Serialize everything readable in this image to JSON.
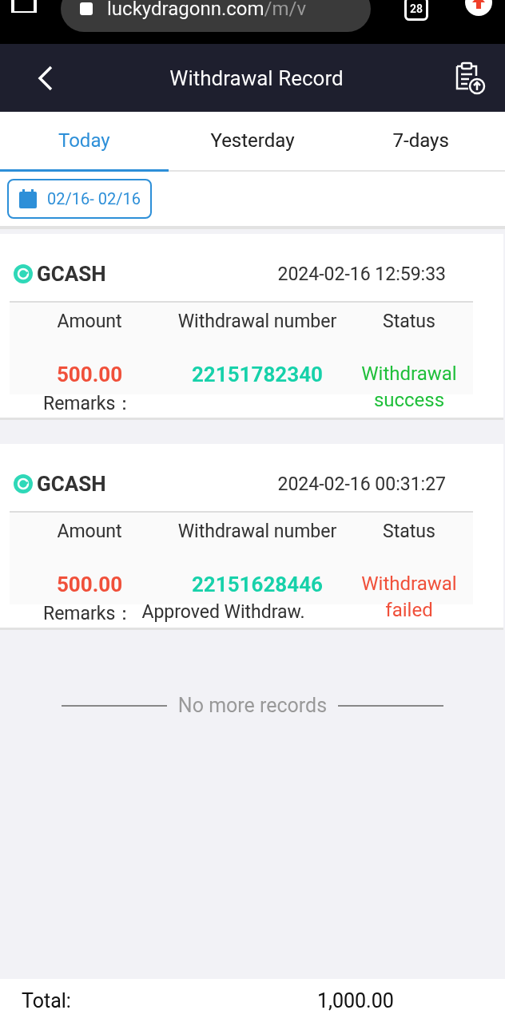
{
  "browser": {
    "url_host": "luckydragonn.com",
    "url_path": "/m/v",
    "tab_count": "28"
  },
  "header": {
    "title": "Withdrawal Record"
  },
  "tabs": [
    {
      "label": "Today",
      "selected": true
    },
    {
      "label": "Yesterday",
      "selected": false
    },
    {
      "label": "7-days",
      "selected": false
    }
  ],
  "date_range": "02/16- 02/16",
  "records": [
    {
      "method": "GCASH",
      "time": "2024-02-16 12:59:33",
      "columns": [
        "Amount",
        "Withdrawal number",
        "Status"
      ],
      "amount": "500.00",
      "number": "22151782340",
      "status": "Withdrawal success",
      "color": "#1fbf3a",
      "remarks_label": "Remarks："
    },
    {
      "method": "GCASH",
      "time": "2024-02-16 00:31:27",
      "columns": [
        "Amount",
        "Withdrawal number",
        "Status"
      ],
      "amount": "500.00",
      "number": "22151628446",
      "status": "Withdrawal failed",
      "color": "#f0503a",
      "remarks_label": "Remarks：",
      "remarks": "Approved Withdraw."
    }
  ],
  "end_note": "No more records",
  "total": {
    "label": "Total:",
    "value": "1,000.00"
  }
}
